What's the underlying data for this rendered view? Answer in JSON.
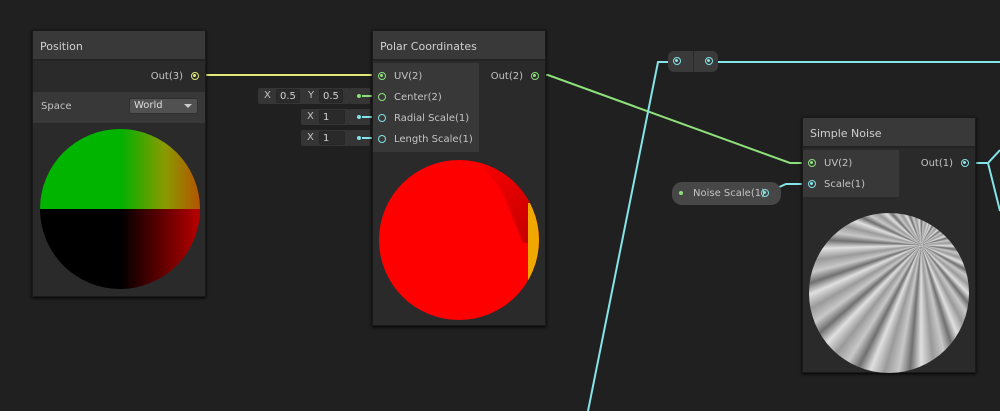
{
  "colors": {
    "vector2": "#8ee07a",
    "vector3": "#e0e87a",
    "float": "#84e4e7",
    "canvas": "#202020"
  },
  "position_node": {
    "title": "Position",
    "out_label": "Out(3)",
    "space_label": "Space",
    "space_value": "World"
  },
  "polar_node": {
    "title": "Polar Coordinates",
    "inputs": [
      "UV(2)",
      "Center(2)",
      "Radial Scale(1)",
      "Length Scale(1)"
    ],
    "out_label": "Out(2)",
    "center": {
      "x_label": "X",
      "x": "0.5",
      "y_label": "Y",
      "y": "0.5"
    },
    "radial_scale": {
      "x_label": "X",
      "x": "1"
    },
    "length_scale": {
      "x_label": "X",
      "x": "1"
    }
  },
  "noise_node": {
    "title": "Simple Noise",
    "inputs": [
      "UV(2)",
      "Scale(1)"
    ],
    "out_label": "Out(1)"
  },
  "property": {
    "label": "Noise Scale(1)"
  }
}
